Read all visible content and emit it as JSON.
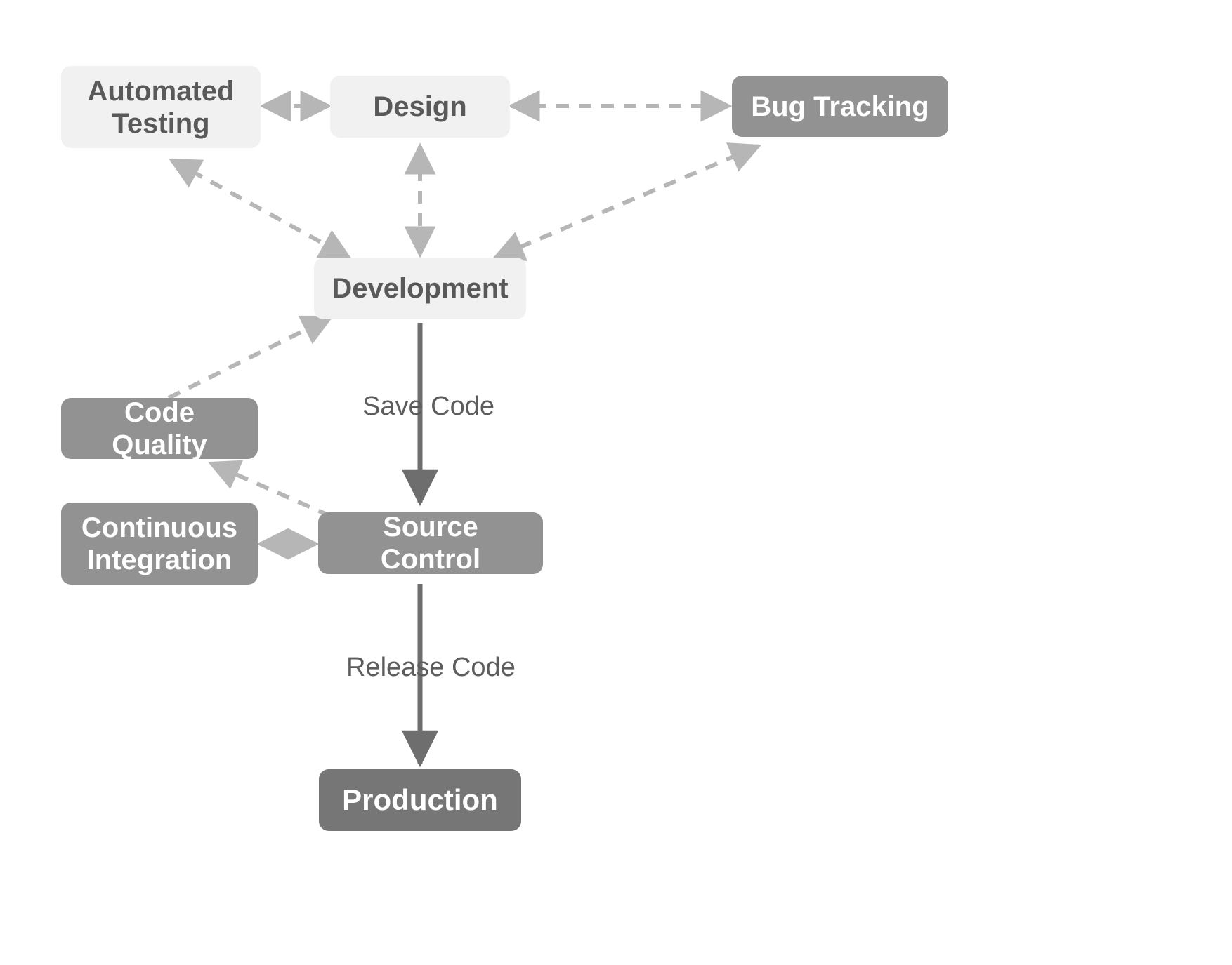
{
  "nodes": {
    "automated_testing": {
      "label": "Automated\nTesting",
      "style": "light"
    },
    "design": {
      "label": "Design",
      "style": "light"
    },
    "bug_tracking": {
      "label": "Bug Tracking",
      "style": "dark"
    },
    "development": {
      "label": "Development",
      "style": "light"
    },
    "code_quality": {
      "label": "Code Quality",
      "style": "dark"
    },
    "continuous_integration": {
      "label": "Continuous\nIntegration",
      "style": "dark"
    },
    "source_control": {
      "label": "Source Control",
      "style": "dark"
    },
    "production": {
      "label": "Production",
      "style": "darker"
    }
  },
  "edge_labels": {
    "save_code": "Save Code",
    "release_code": "Release Code"
  },
  "edges": [
    {
      "from": "design",
      "to": "automated_testing",
      "style": "dashed",
      "bidirectional": true
    },
    {
      "from": "design",
      "to": "bug_tracking",
      "style": "dashed",
      "bidirectional": true
    },
    {
      "from": "design",
      "to": "development",
      "style": "dashed",
      "bidirectional": true
    },
    {
      "from": "automated_testing",
      "to": "development",
      "style": "dashed",
      "bidirectional": true
    },
    {
      "from": "bug_tracking",
      "to": "development",
      "style": "dashed",
      "bidirectional": true
    },
    {
      "from": "code_quality",
      "to": "development",
      "style": "dashed",
      "bidirectional": false,
      "direction": "to"
    },
    {
      "from": "development",
      "to": "source_control",
      "style": "solid",
      "bidirectional": false,
      "label_key": "save_code"
    },
    {
      "from": "source_control",
      "to": "code_quality",
      "style": "dashed",
      "bidirectional": false,
      "direction": "to"
    },
    {
      "from": "source_control",
      "to": "continuous_integration",
      "style": "dashed",
      "bidirectional": true
    },
    {
      "from": "source_control",
      "to": "production",
      "style": "solid",
      "bidirectional": false,
      "label_key": "release_code"
    }
  ],
  "colors": {
    "node_light_bg": "#f1f1f1",
    "node_light_text": "#595959",
    "node_dark_bg": "#929292",
    "node_darker_bg": "#767676",
    "arrow_dashed": "#b6b6b6",
    "arrow_solid": "#6e6e6e",
    "label_text": "#5d5d5d"
  }
}
